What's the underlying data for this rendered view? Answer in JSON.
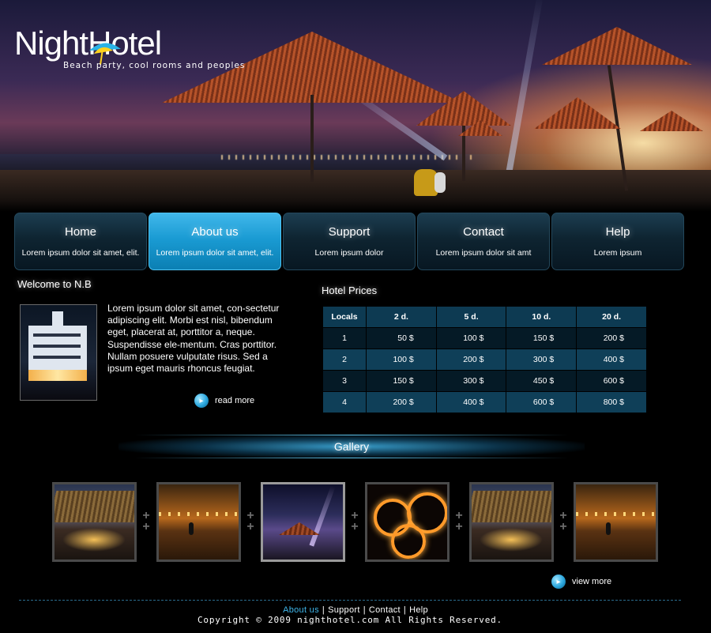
{
  "brand": {
    "name_part1": "Night",
    "name_part2": "Hotel",
    "tagline": "Beach party, cool rooms and peoples"
  },
  "nav": [
    {
      "title": "Home",
      "subtitle": "Lorem ipsum dolor sit amet, elit.",
      "active": false
    },
    {
      "title": "About us",
      "subtitle": "Lorem ipsum dolor sit amet, elit.",
      "active": true
    },
    {
      "title": "Support",
      "subtitle": "Lorem ipsum dolor",
      "active": false
    },
    {
      "title": "Contact",
      "subtitle": "Lorem ipsum dolor sit amt",
      "active": false
    },
    {
      "title": "Help",
      "subtitle": "Lorem ipsum",
      "active": false
    }
  ],
  "welcome": {
    "heading": "Welcome to N.B",
    "text": "Lorem ipsum dolor sit amet, con-sectetur adipiscing elit. Morbi est nisl, bibendum eget, placerat at, porttitor a, neque. Suspendisse ele-mentum. Cras porttitor. Nullam posuere vulputate risus. Sed a ipsum eget mauris rhoncus feugiat.",
    "read_more": "read more"
  },
  "prices": {
    "heading": "Hotel Prices",
    "columns": [
      "Locals",
      "2 d.",
      "5 d.",
      "10 d.",
      "20 d."
    ],
    "rows": [
      [
        "1",
        "50 $",
        "100 $",
        "150 $",
        "200 $"
      ],
      [
        "2",
        "100 $",
        "200 $",
        "300 $",
        "400 $"
      ],
      [
        "3",
        "150 $",
        "300 $",
        "450 $",
        "600 $"
      ],
      [
        "4",
        "200 $",
        "400 $",
        "600 $",
        "800 $"
      ]
    ]
  },
  "gallery": {
    "title": "Gallery",
    "view_more": "view more",
    "selected_index": 2
  },
  "footer": {
    "links": [
      "About us",
      "Support",
      "Contact",
      "Help"
    ],
    "current": "About us",
    "copyright": "Copyright © 2009 nighthotel.com All Rights Reserved."
  },
  "colors": {
    "accent": "#1a9bd3",
    "nav_bg": "#0e2431",
    "table_dark": "#051a26",
    "table_light": "#0f3f58"
  }
}
